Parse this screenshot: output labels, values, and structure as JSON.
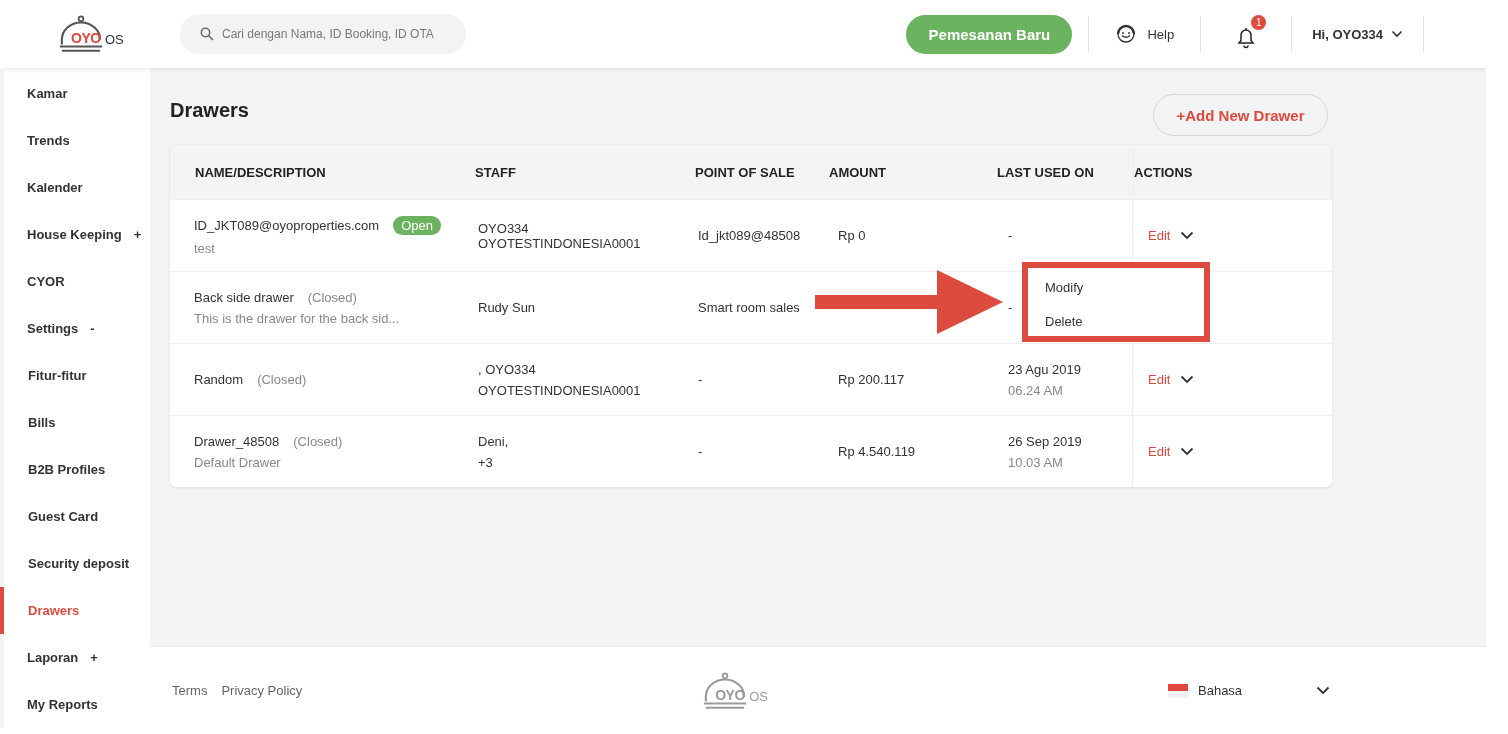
{
  "header": {
    "logo": {
      "brand": "OYO",
      "suffix": "OS"
    },
    "search": {
      "placeholder": "Cari dengan Nama, ID Booking, ID OTA"
    },
    "new_booking_button": "Pemesanan Baru",
    "help": "Help",
    "notifications": {
      "count": "1"
    },
    "user_menu": "Hi, OYO334"
  },
  "sidebar": {
    "items": [
      {
        "label": "Kamar",
        "selected": false
      },
      {
        "label": "Trends",
        "selected": false
      },
      {
        "label": "Kalender",
        "selected": false
      },
      {
        "label": "House Keeping",
        "toggle": "+",
        "selected": false
      },
      {
        "label": "CYOR",
        "selected": false
      },
      {
        "label": "Settings",
        "toggle": "-",
        "selected": false,
        "children": [
          {
            "label": "Fitur-fitur",
            "selected": false
          },
          {
            "label": "Bills",
            "selected": false
          },
          {
            "label": "B2B Profiles",
            "selected": false
          },
          {
            "label": "Guest Card",
            "selected": false
          },
          {
            "label": "Security deposit",
            "selected": false
          },
          {
            "label": "Drawers",
            "selected": true
          }
        ]
      },
      {
        "label": "Laporan",
        "toggle": "+",
        "selected": false
      },
      {
        "label": "My Reports",
        "selected": false
      }
    ]
  },
  "page": {
    "title": "Drawers",
    "add_button": "+Add New Drawer"
  },
  "table": {
    "columns": [
      "NAME/DESCRIPTION",
      "STAFF",
      "POINT OF SALE",
      "AMOUNT",
      "LAST USED ON",
      "ACTIONS"
    ],
    "rows": [
      {
        "name": "ID_JKT089@oyoproperties.com",
        "status": "Open",
        "open": true,
        "description": "test",
        "staff": [
          "OYO334 OYOTESTINDONESIA0001"
        ],
        "point_of_sale": "Id_jkt089@48508",
        "amount": "Rp 0",
        "last_used": {
          "date": "-"
        },
        "action": "Edit"
      },
      {
        "name": "Back side drawer",
        "status": "(Closed)",
        "open": false,
        "description": "This is the drawer for the back sid...",
        "staff": [
          "Rudy Sun"
        ],
        "point_of_sale": "Smart room sales",
        "last_used": {
          "date": "-"
        }
      },
      {
        "name": "Random",
        "status": "(Closed)",
        "open": false,
        "staff": [
          ", OYO334",
          "OYOTESTINDONESIA0001"
        ],
        "point_of_sale": "-",
        "amount": "Rp 200.117",
        "last_used": {
          "date": "23 Agu 2019",
          "time": "06.24 AM"
        },
        "action": "Edit"
      },
      {
        "name": "Drawer_48508",
        "status": "(Closed)",
        "open": false,
        "description": "Default Drawer",
        "staff": [
          "Deni,",
          "+3"
        ],
        "point_of_sale": "-",
        "amount": "Rp 4.540.119",
        "last_used": {
          "date": "26 Sep 2019",
          "time": "10.03 AM"
        },
        "action": "Edit"
      }
    ],
    "dropdown": {
      "items": [
        "Modify",
        "Delete"
      ]
    }
  },
  "footer": {
    "links": [
      "Terms",
      "Privacy Policy"
    ],
    "logo": {
      "brand": "OYO",
      "suffix": "OS"
    },
    "language": "Bahasa"
  }
}
